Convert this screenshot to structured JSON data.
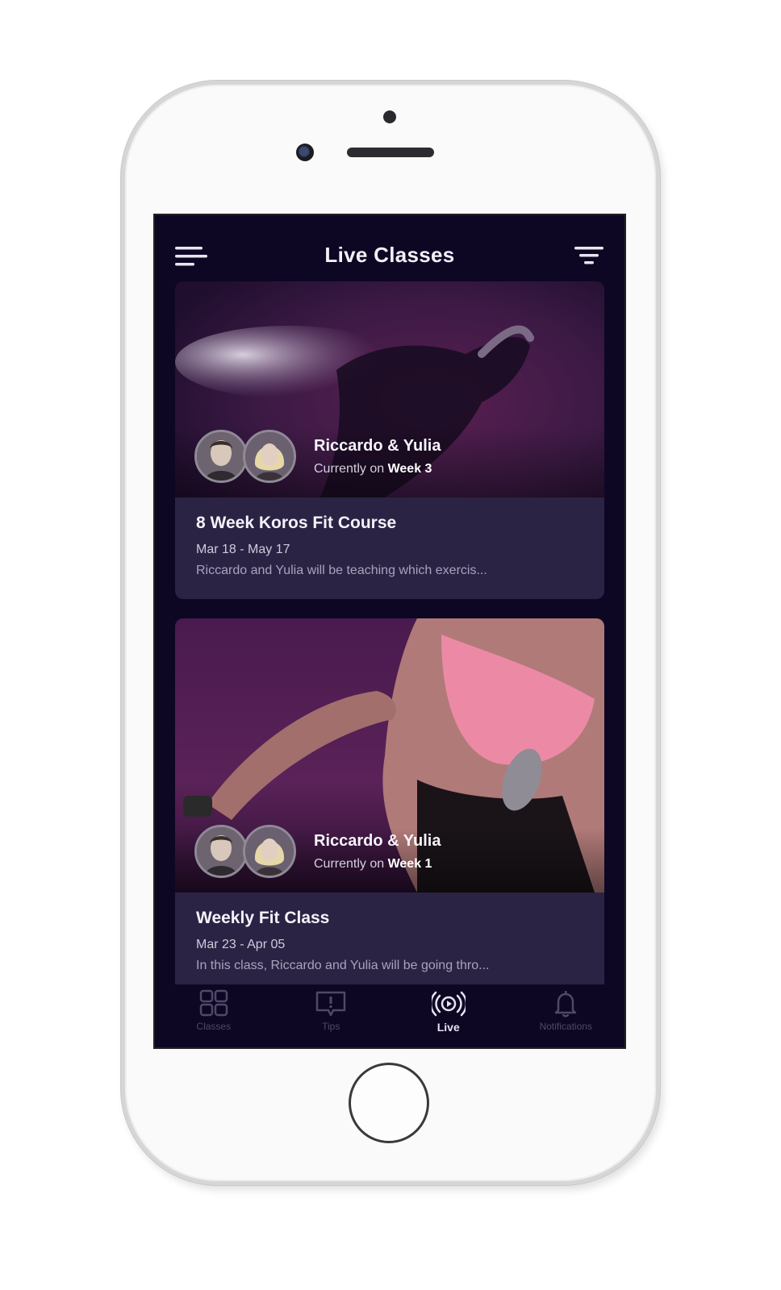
{
  "header": {
    "title": "Live Classes",
    "menu_icon": "menu-icon",
    "filter_icon": "filter-icon"
  },
  "classes": [
    {
      "trainers": "Riccardo & Yulia",
      "currently_prefix": "Currently on ",
      "week": "Week 3",
      "title": "8 Week Koros Fit Course",
      "dates": "Mar 18 - May 17",
      "description": "Riccardo and Yulia will be teaching which exercis..."
    },
    {
      "trainers": "Riccardo & Yulia",
      "currently_prefix": "Currently on ",
      "week": "Week 1",
      "title": "Weekly Fit Class",
      "dates": "Mar 23 - Apr 05",
      "description": "In this class, Riccardo and Yulia will be going thro..."
    }
  ],
  "nav": [
    {
      "label": "Classes",
      "icon": "grid-icon"
    },
    {
      "label": "Tips",
      "icon": "tips-icon"
    },
    {
      "label": "Live",
      "icon": "live-icon",
      "active": true
    },
    {
      "label": "Notifications",
      "icon": "bell-icon"
    }
  ],
  "colors": {
    "background": "#0d0724",
    "card_body": "#2b2344",
    "accent": "#5a1f52"
  }
}
